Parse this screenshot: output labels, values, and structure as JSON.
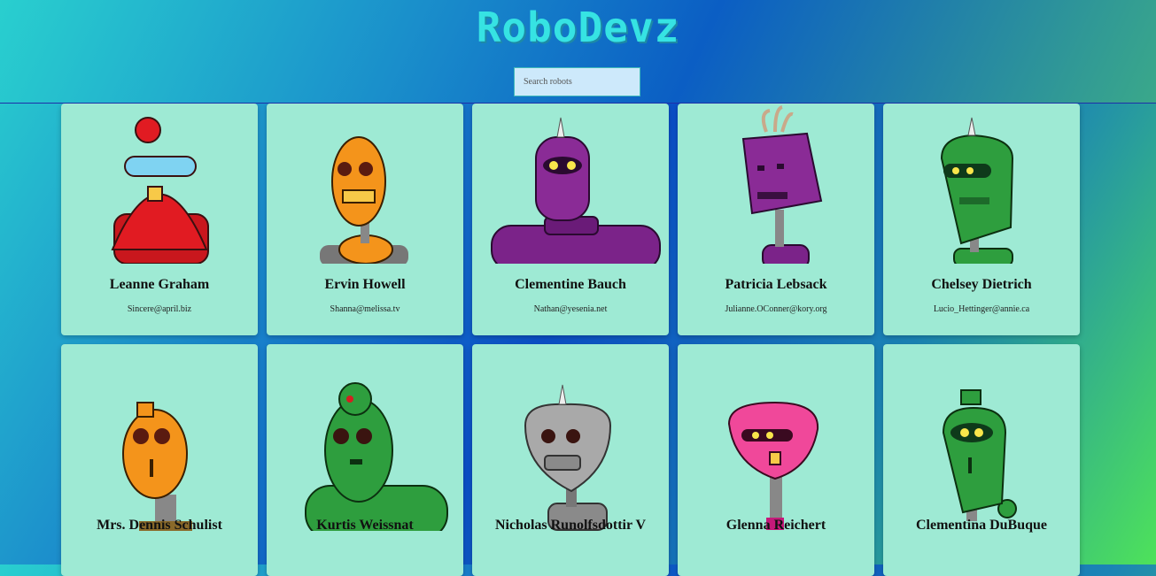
{
  "app": {
    "title": "RoboDevz"
  },
  "search": {
    "placeholder": "Search robots"
  },
  "robots": [
    {
      "name": "Leanne Graham",
      "email": "Sincere@april.biz",
      "color": "#e11b22"
    },
    {
      "name": "Ervin Howell",
      "email": "Shanna@melissa.tv",
      "color": "#f4941b"
    },
    {
      "name": "Clementine Bauch",
      "email": "Nathan@yesenia.net",
      "color": "#8a2b96"
    },
    {
      "name": "Patricia Lebsack",
      "email": "Julianne.OConner@kory.org",
      "color": "#7b2389"
    },
    {
      "name": "Chelsey Dietrich",
      "email": "Lucio_Hettinger@annie.ca",
      "color": "#2e9e3e"
    },
    {
      "name": "Mrs. Dennis Schulist",
      "email": "",
      "color": "#f4941b"
    },
    {
      "name": "Kurtis Weissnat",
      "email": "",
      "color": "#2e9e3e"
    },
    {
      "name": "Nicholas Runolfsdottir V",
      "email": "",
      "color": "#9a9a9a"
    },
    {
      "name": "Glenna Reichert",
      "email": "",
      "color": "#f0489a"
    },
    {
      "name": "Clementina DuBuque",
      "email": "",
      "color": "#2e9e3e"
    }
  ]
}
